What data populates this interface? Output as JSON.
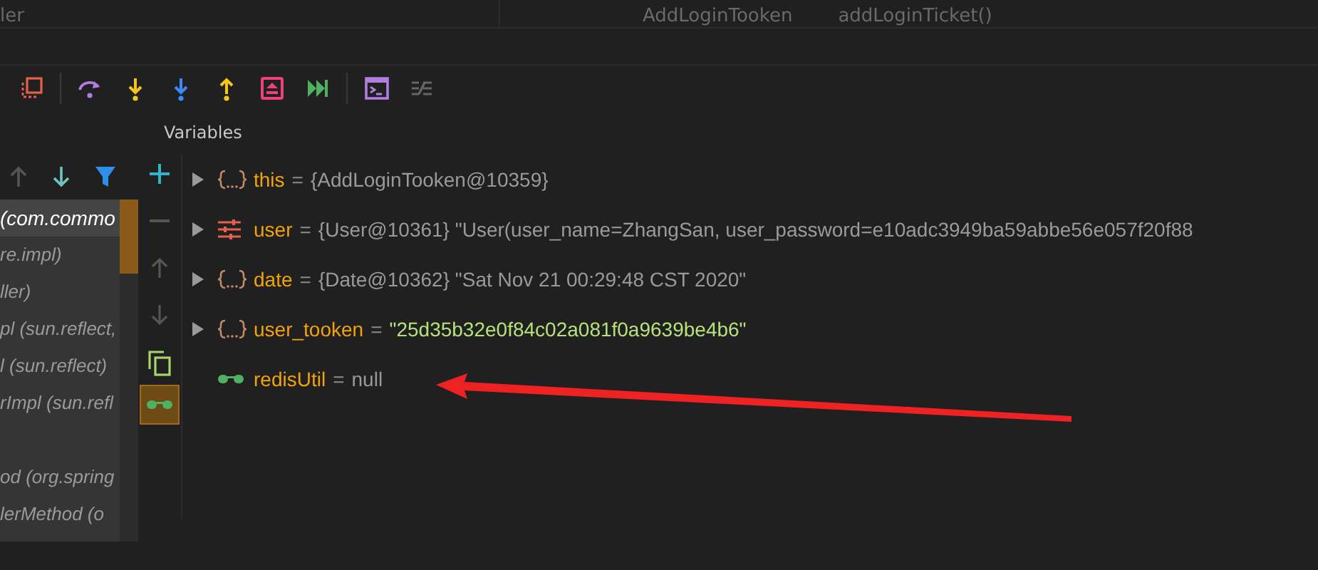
{
  "editor_tabs": [
    {
      "label": "ler"
    },
    {
      "label": "AddLoginTooken"
    },
    {
      "label": "addLoginTicket()"
    }
  ],
  "variables_panel": {
    "title": "Variables"
  },
  "frames": [
    {
      "label": "(com.commo",
      "selected": true
    },
    {
      "label": "re.impl)",
      "selected": false
    },
    {
      "label": "ller)",
      "selected": false
    },
    {
      "label": "pl (sun.reflect,",
      "selected": false
    },
    {
      "label": "l (sun.reflect)",
      "selected": false
    },
    {
      "label": "rImpl (sun.refl",
      "selected": false
    },
    {
      "selected": false
    },
    {
      "label": "od (org.spring",
      "selected": false
    },
    {
      "label": "lerMethod (o",
      "selected": false
    }
  ],
  "watches_toggle": {
    "on": true
  },
  "variables": [
    {
      "kind": "object",
      "expandable": true,
      "name": "this",
      "separator": "=",
      "value": "{AddLoginTooken@10359}"
    },
    {
      "kind": "fields",
      "expandable": true,
      "name": "user",
      "separator": "=",
      "value": "{User@10361} \"User(user_name=ZhangSan, user_password=e10adc3949ba59abbe56e057f20f88"
    },
    {
      "kind": "object",
      "expandable": true,
      "name": "date",
      "separator": "=",
      "value": "{Date@10362} \"Sat Nov 21 00:29:48 CST 2020\""
    },
    {
      "kind": "object",
      "expandable": true,
      "name": "user_tooken",
      "separator": "=",
      "string_value": "\"25d35b32e0f84c02a081f0a9639be4b6\""
    },
    {
      "kind": "watch",
      "expandable": false,
      "name": "redisUtil",
      "separator": "=",
      "value": "null"
    }
  ]
}
